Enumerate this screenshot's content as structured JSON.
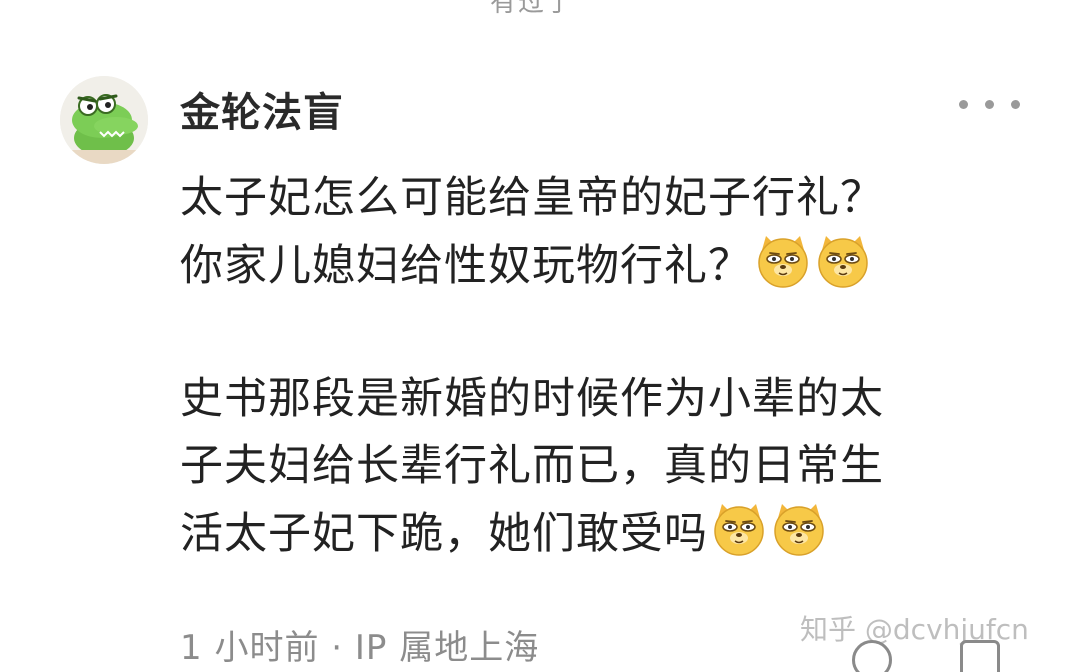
{
  "top_cut": {
    "text": "有过了"
  },
  "comment": {
    "author": "金轮法盲",
    "lines_1": [
      "太子妃怎么可能给皇帝的妃子行礼？",
      "你家儿媳妇给性奴玩物行礼？"
    ],
    "lines_2": [
      "史书那段是新婚的时候作为小辈的太",
      "子夫妇给长辈行礼而已，真的日常生",
      "活太子妃下跪，她们敢受吗"
    ],
    "time": "1 小时前",
    "separator": " · ",
    "ip_location": "IP 属地上海"
  },
  "watermark": "知乎 @dcvhjufcn",
  "icons": {
    "avatar": "crocodile-avatar",
    "more": "more-dots-icon",
    "emoji": "doge-emoji",
    "reply": "reply-icon",
    "like": "like-icon"
  }
}
